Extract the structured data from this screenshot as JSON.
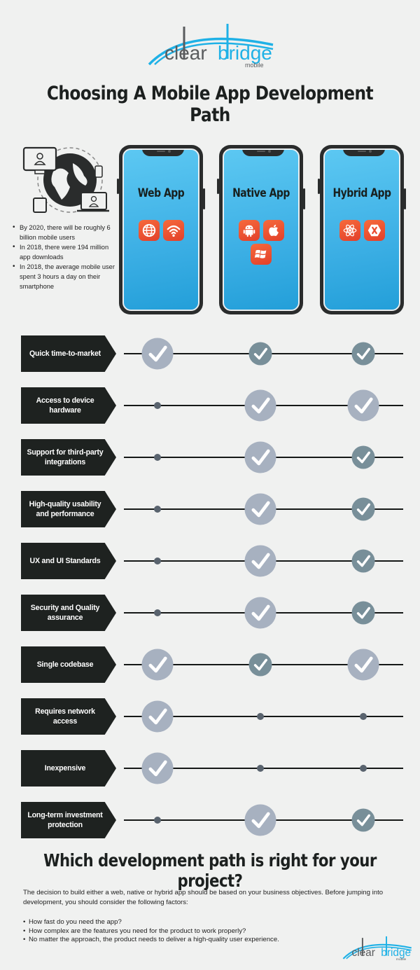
{
  "brand": {
    "name_part1": "clear",
    "name_part2": "bridge",
    "tagline": "mobile",
    "colors": {
      "gray": "#5a5c5e",
      "blue": "#1fb1e6"
    }
  },
  "title": "Choosing A Mobile App Development Path",
  "stats": {
    "illustration": "globe-with-devices-icon",
    "items": [
      "By 2020, there will be roughly 6 billion mobile users",
      "In 2018, there were 194 million app downloads",
      "In 2018, the average mobile user spent 3 hours a day on their smartphone"
    ]
  },
  "app_types": [
    {
      "label": "Web App",
      "icons": [
        "globe-icon",
        "wifi-icon"
      ]
    },
    {
      "label": "Native App",
      "icons": [
        "android-icon",
        "apple-icon",
        "windows-icon"
      ]
    },
    {
      "label": "Hybrid App",
      "icons": [
        "react-icon",
        "xamarin-icon"
      ]
    }
  ],
  "legend": {
    "big_check": "strong fit",
    "small_check": "fit",
    "dot": "not a fit"
  },
  "criteria": [
    {
      "label": "Quick time-to-market",
      "values": [
        "big",
        "small",
        "small"
      ]
    },
    {
      "label": "Access to device hardware",
      "values": [
        "dot",
        "big",
        "big"
      ]
    },
    {
      "label": "Support for third-party integrations",
      "values": [
        "dot",
        "big",
        "small"
      ]
    },
    {
      "label": "High-quality usability and performance",
      "values": [
        "dot",
        "big",
        "small"
      ]
    },
    {
      "label": "UX and UI Standards",
      "values": [
        "dot",
        "big",
        "small"
      ]
    },
    {
      "label": "Security and Quality assurance",
      "values": [
        "dot",
        "big",
        "small"
      ]
    },
    {
      "label": "Single codebase",
      "values": [
        "big",
        "small",
        "big"
      ]
    },
    {
      "label": "Requires network access",
      "values": [
        "big",
        "dot",
        "dot"
      ]
    },
    {
      "label": "Inexpensive",
      "values": [
        "big",
        "dot",
        "dot"
      ]
    },
    {
      "label": "Long-term investment protection",
      "values": [
        "dot",
        "big",
        "small"
      ]
    }
  ],
  "colors": {
    "phone_screen": "#3fb1e6",
    "icon_bg": "#ea4a2e",
    "label_bg": "#1e2220",
    "big_check": "#a7b1c0",
    "small_check": "#788f99",
    "dot": "#59636e"
  },
  "bottom": {
    "title": "Which development path is right for your project?",
    "paragraph": "The decision to build either a web, native or hybrid app should be based on your business objectives. Before jumping into development, you should consider the following factors:",
    "factors": [
      "How fast do you need the app?",
      "How complex are the features you need for the product to work properly?",
      "No matter the approach, the product needs to deliver a high-quality user experience."
    ]
  }
}
